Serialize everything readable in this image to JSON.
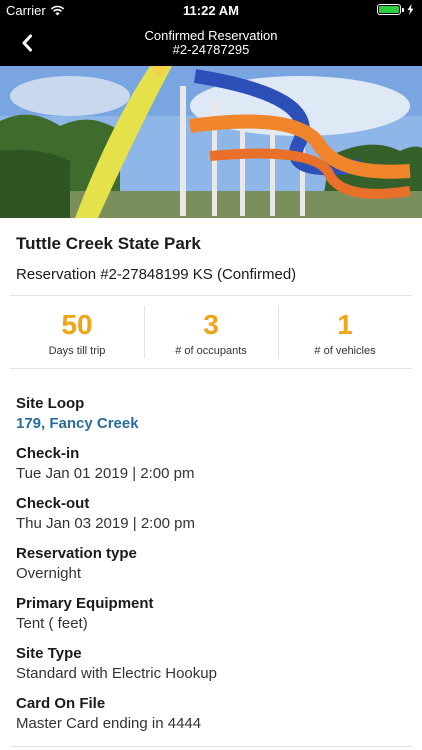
{
  "status_bar": {
    "carrier": "Carrier",
    "time": "11:22 AM"
  },
  "nav": {
    "title_line1": "Confirmed Reservation",
    "title_line2": "#2-24787295"
  },
  "park": {
    "name": "Tuttle Creek State Park",
    "reservation": "Reservation #2-27848199 KS (Confirmed)"
  },
  "stats": [
    {
      "value": "50",
      "label": "Days till trip"
    },
    {
      "value": "3",
      "label": "# of occupants"
    },
    {
      "value": "1",
      "label": "# of vehicles"
    }
  ],
  "details": [
    {
      "label": "Site Loop",
      "value": "179, Fancy Creek"
    },
    {
      "label": "Check-in",
      "value": "Tue Jan 01 2019 | 2:00 pm"
    },
    {
      "label": "Check-out",
      "value": "Thu Jan 03 2019 | 2:00 pm"
    },
    {
      "label": "Reservation type",
      "value": "Overnight"
    },
    {
      "label": "Primary Equipment",
      "value": "Tent ( feet)"
    },
    {
      "label": "Site Type",
      "value": "Standard with Electric Hookup"
    },
    {
      "label": "Card On File",
      "value": "Master Card ending in 4444"
    }
  ],
  "colors": {
    "accent": "#f0a418",
    "link": "#2a6c9b",
    "battery": "#2ecc40"
  }
}
